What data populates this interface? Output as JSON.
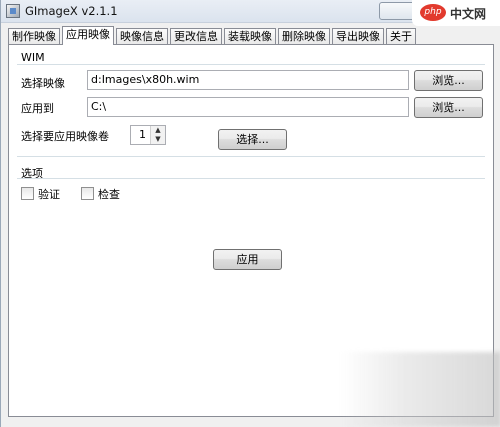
{
  "window": {
    "title": "GImageX v2.1.1"
  },
  "watermark": {
    "logo": "php",
    "text": "中文网"
  },
  "tabs": [
    {
      "label": "制作映像",
      "active": false
    },
    {
      "label": "应用映像",
      "active": true
    },
    {
      "label": "映像信息",
      "active": false
    },
    {
      "label": "更改信息",
      "active": false
    },
    {
      "label": "装载映像",
      "active": false
    },
    {
      "label": "删除映像",
      "active": false
    },
    {
      "label": "导出映像",
      "active": false
    },
    {
      "label": "关于",
      "active": false
    }
  ],
  "wim": {
    "group_label": "WIM",
    "select_image_label": "选择映像",
    "select_image_value": "d:Images\\x80h.wim",
    "apply_to_label": "应用到",
    "apply_to_value": "C:\\",
    "browse_label": "浏览...",
    "volume_label": "选择要应用映像卷",
    "volume_value": "1",
    "choose_label": "选择..."
  },
  "options": {
    "group_label": "选项",
    "verify_label": "验证",
    "verify_checked": false,
    "check_label": "检查",
    "check_checked": false
  },
  "apply_button": "应用"
}
